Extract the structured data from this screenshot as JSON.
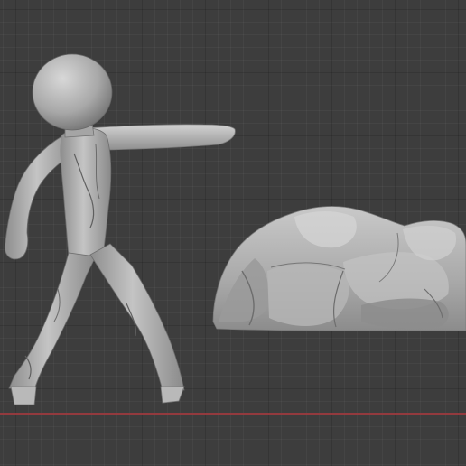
{
  "viewport": {
    "background_color": "#3d3d3d",
    "grid_line_color": "#353535",
    "axis_x_color": "#9c3a3e",
    "mesh_color": "#b3b3b3"
  },
  "scene": {
    "objects": [
      "stick-figure-mesh",
      "rock-mesh"
    ]
  }
}
